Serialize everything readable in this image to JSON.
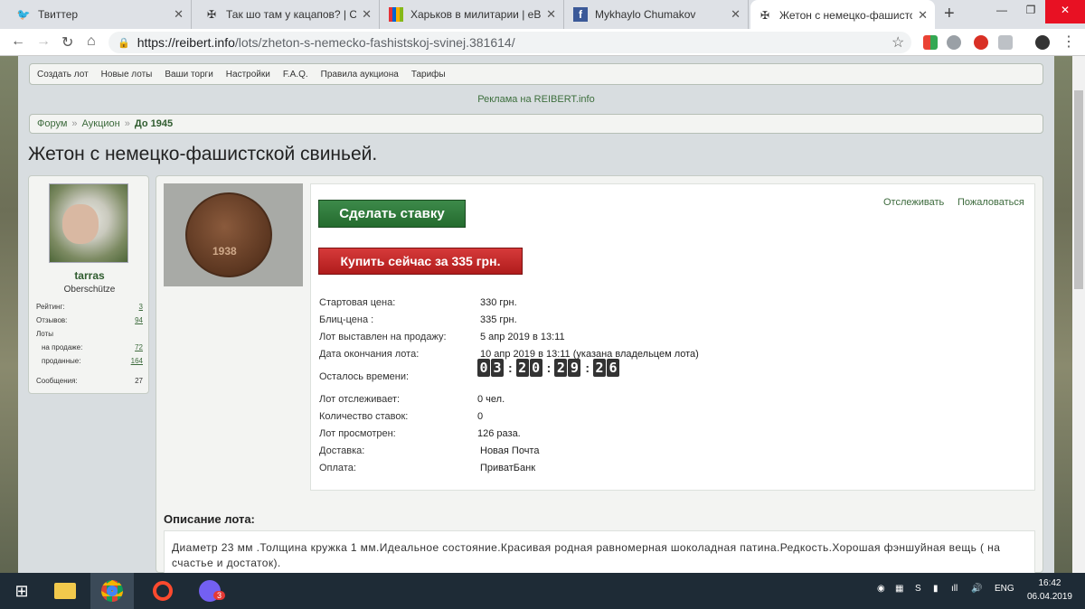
{
  "browser": {
    "tabs": [
      {
        "title": "Твиттер",
        "icon": "twitter-icon"
      },
      {
        "title": "Так шо там у кацапов? | Стран",
        "icon": "cross-icon"
      },
      {
        "title": "Харьков в милитарии | eBay",
        "icon": "ebay-icon"
      },
      {
        "title": "Mykhaylo Chumakov",
        "icon": "facebook-icon"
      },
      {
        "title": "Жетон с немецко-фашистской",
        "icon": "cross-icon"
      }
    ],
    "url_host": "https://reibert.info",
    "url_path": "/lots/zheton-s-nemecko-fashistskoj-svinej.381614/"
  },
  "site": {
    "topnav": [
      "Создать лот",
      "Новые лоты",
      "Ваши торги",
      "Настройки",
      "F.A.Q.",
      "Правила аукциона",
      "Тарифы"
    ],
    "ad_text": "Реклама на REIBERT.info",
    "breadcrumb": {
      "item1": "Форум",
      "item2": "Аукцион",
      "current": "До 1945",
      "sep": "»"
    },
    "page_title": "Жетон с немецко-фашистской свиньей."
  },
  "user": {
    "name": "tarras",
    "rank": "Oberschütze",
    "stats": {
      "rating_label": "Рейтинг:",
      "rating": "3",
      "reviews_label": "Отзывов:",
      "reviews": "94",
      "lots_label": "Лоты",
      "on_sale_label": "на продаже:",
      "on_sale": "72",
      "sold_label": "проданные:",
      "sold": "164",
      "messages_label": "Сообщения:",
      "messages": "27"
    }
  },
  "lot": {
    "coin_year": "1938",
    "bid_button": "Сделать ставку",
    "buy_button": "Купить сейчас за 335 грн.",
    "watch_link": "Отслеживать",
    "report_link": "Пожаловаться",
    "start_price_label": "Стартовая цена:",
    "start_price": "330 грн.",
    "blitz_label": "Блиц-цена :",
    "blitz": "335 грн.",
    "listed_label": "Лот выставлен на продажу:",
    "listed": "5 апр 2019 в 13:11",
    "end_label": "Дата окончания лота:",
    "end": "10 апр 2019 в 13:11 (указана владельцем лота)",
    "remaining_label": "Осталось времени:",
    "timer": {
      "d1": "0",
      "d2": "3",
      "h1": "2",
      "h2": "0",
      "m1": "2",
      "m2": "9",
      "s1": "2",
      "s2": "6",
      "sep": ":"
    },
    "watchers_label": "Лот отслеживает:",
    "watchers": "0 чел.",
    "bids_label": "Количество ставок:",
    "bids": "0",
    "views_label": "Лот просмотрен:",
    "views": "126 раза.",
    "delivery_label": "Доставка:",
    "delivery": "Новая Почта",
    "payment_label": "Оплата:",
    "payment": "ПриватБанк",
    "description_heading": "Описание лота:",
    "description": "Диаметр 23 мм .Толщина кружка 1 мм.Идеальное состояние.Красивая родная равномерная шоколадная патина.Редкость.Хорошая фэншуйная вещь ( на счастье и достаток)."
  },
  "taskbar": {
    "lang": "ENG",
    "time": "16:42",
    "date": "06.04.2019",
    "viber_badge": "3"
  }
}
